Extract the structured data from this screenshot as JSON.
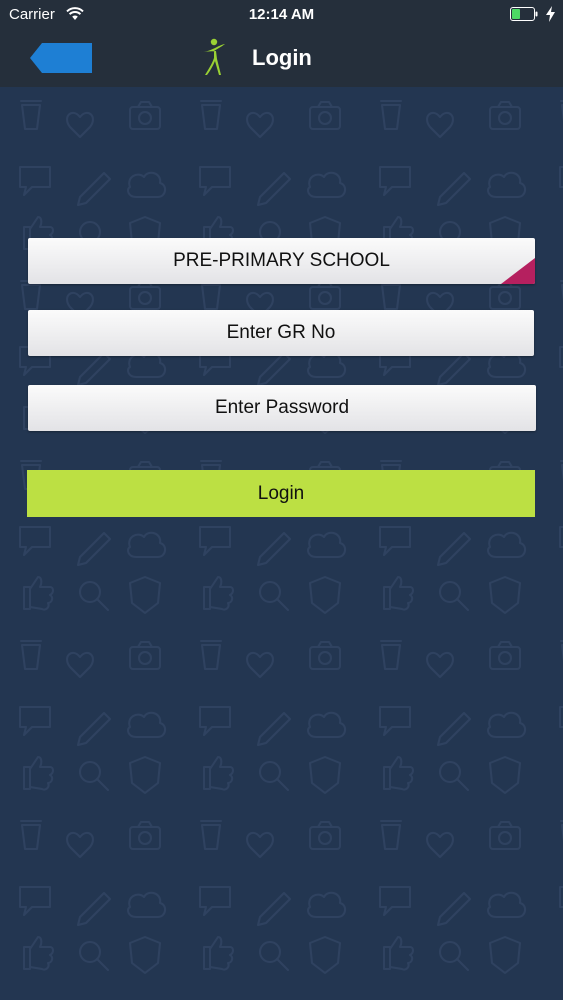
{
  "status_bar": {
    "carrier": "Carrier",
    "time": "12:14 AM",
    "wifi_icon": "wifi-icon",
    "battery_icon": "battery-charging-icon"
  },
  "nav_bar": {
    "title": "Login",
    "back_icon": "back-arrow-icon",
    "logo_icon": "person-logo-icon"
  },
  "form": {
    "school_select": {
      "value": "PRE-PRIMARY SCHOOL"
    },
    "gr_number": {
      "placeholder": "Enter GR No",
      "value": ""
    },
    "password": {
      "placeholder": "Enter Password",
      "value": ""
    },
    "login_label": "Login"
  },
  "colors": {
    "background": "#233651",
    "bar_background": "#252f3b",
    "back_button": "#1e7fd4",
    "logo_green": "#9ad134",
    "login_button": "#bce043",
    "select_corner": "#b5205f",
    "battery_level": "#4cd964"
  }
}
